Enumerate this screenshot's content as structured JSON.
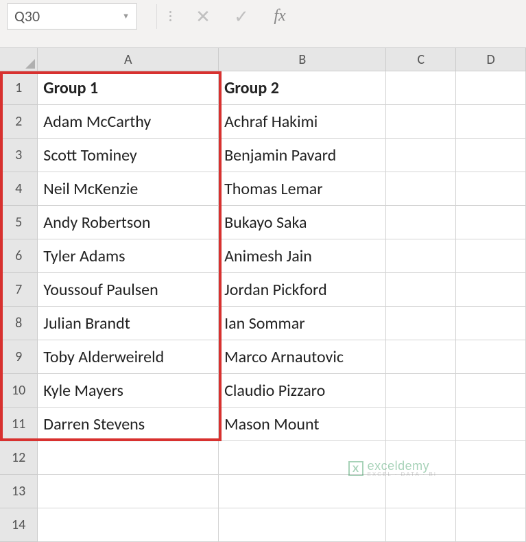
{
  "formula_bar": {
    "name_box": "Q30",
    "cancel_glyph": "✕",
    "enter_glyph": "✓",
    "fx_label": "fx"
  },
  "columns": [
    "A",
    "B",
    "C",
    "D"
  ],
  "row_numbers": [
    "1",
    "2",
    "3",
    "4",
    "5",
    "6",
    "7",
    "8",
    "9",
    "10",
    "11",
    "12",
    "13",
    "14"
  ],
  "headers": {
    "a": "Group 1",
    "b": "Group 2"
  },
  "data": {
    "a": [
      "Adam McCarthy",
      "Scott Tominey",
      "Neil McKenzie",
      "Andy Robertson",
      "Tyler Adams",
      "Youssouf Paulsen",
      "Julian Brandt",
      "Toby Alderweireld",
      "Kyle Mayers",
      "Darren Stevens"
    ],
    "b": [
      "Achraf Hakimi",
      "Benjamin Pavard",
      "Thomas Lemar",
      "Bukayo Saka",
      "Animesh Jain",
      "Jordan Pickford",
      "Ian Sommar",
      "Marco Arnautovic",
      "Claudio Pizzaro",
      "Mason Mount"
    ]
  },
  "watermark": {
    "main": "exceldemy",
    "sub": "EXCEL · DATA · BI"
  }
}
